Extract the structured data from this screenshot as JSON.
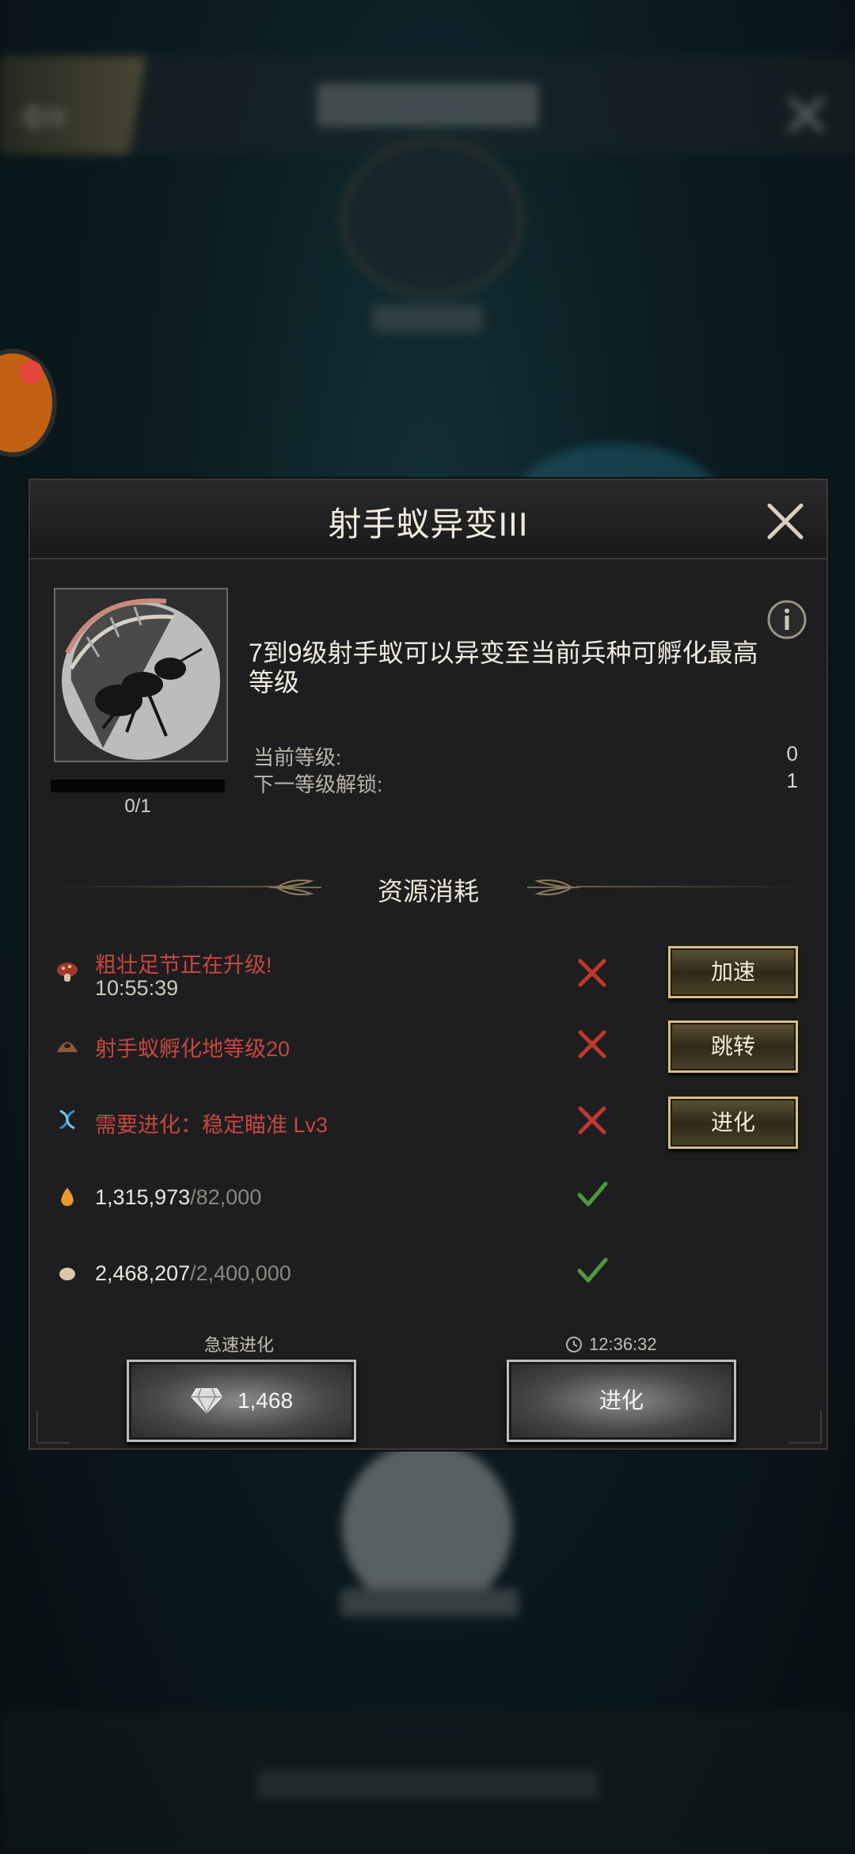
{
  "background": {
    "back_arrow": "⇦",
    "close_glyph": "✕"
  },
  "modal": {
    "title": "射手蚁异变III",
    "description": "7到9级射手蚁可以异变至当前兵种可孵化最高等级",
    "progress": {
      "text": "0/1",
      "fraction": 0
    },
    "stats": [
      {
        "label": "当前等级:",
        "value": "0"
      },
      {
        "label": "下一等级解锁:",
        "value": "1"
      }
    ],
    "section_title": "资源消耗",
    "requirements": [
      {
        "icon": "mushroom-icon",
        "text": "粗壮足节正在升级!",
        "sub": "10:55:39",
        "met": false,
        "button": "加速"
      },
      {
        "icon": "anthill-icon",
        "text": "射手蚁孵化地等级20",
        "met": false,
        "button": "跳转"
      },
      {
        "icon": "dna-icon",
        "text": "需要进化：稳定瞄准 Lv3",
        "met": false,
        "button": "进化"
      },
      {
        "icon": "water-drop-icon",
        "have": "1,315,973",
        "need": "/82,000",
        "met": true
      },
      {
        "icon": "seed-icon",
        "have": "2,468,207",
        "need": "/2,400,000",
        "met": true
      }
    ],
    "footer": {
      "instant_label": "急速进化",
      "instant_cost": "1,468",
      "timer": "12:36:32",
      "evolve_label": "进化"
    }
  },
  "colors": {
    "accent_gold": "#d4bf7e",
    "unmet_red": "#c8473f",
    "met_green": "#4e9a3e"
  }
}
